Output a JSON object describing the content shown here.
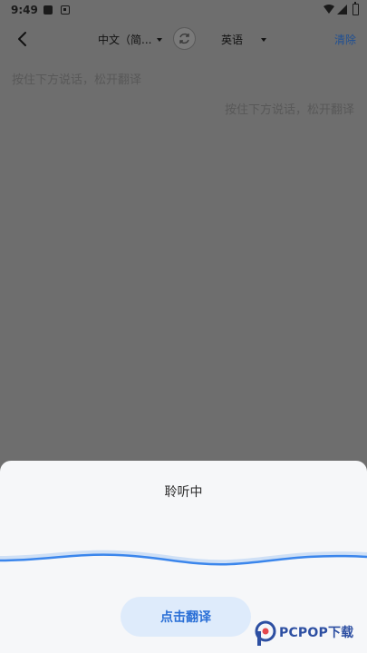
{
  "status_bar": {
    "time": "9:49"
  },
  "toolbar": {
    "source_language": "中文（简...",
    "target_language": "英语",
    "clear_label": "清除"
  },
  "source": {
    "placeholder": "按住下方说话，松开翻译"
  },
  "target": {
    "placeholder": "按住下方说话，松开翻译"
  },
  "listening_sheet": {
    "title": "聆听中",
    "translate_button": "点击翻译"
  },
  "watermark": {
    "brand": "PCPOP下载"
  },
  "colors": {
    "accent": "#2a6fd6",
    "wave": "#3b86ec",
    "overlay": "#6e6e6e",
    "sheet": "#f6f7f9"
  }
}
